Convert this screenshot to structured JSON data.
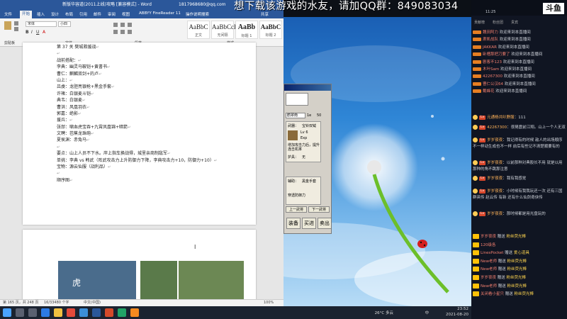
{
  "overlay": {
    "text": "想下载该游戏的水友，请加QQ群：849083034"
  },
  "word": {
    "title": "新版华容道(2011上线)攻略 [兼容模式] - Word",
    "user": "1817968680@qq.com",
    "tabs": [
      "文件",
      "开始",
      "插入",
      "设计",
      "布局",
      "引用",
      "邮件",
      "审阅",
      "视图",
      "ABBYY FineReader 11",
      "操作说明搜索"
    ],
    "active_tab": "开始",
    "share": "共享",
    "font_name": "宋体",
    "font_size": "小四",
    "styles": [
      {
        "sample": "AaBbC",
        "name": "正文"
      },
      {
        "sample": "AaBbCcI",
        "name": "无间隔"
      },
      {
        "sample": "AaBb",
        "name": "标题 1"
      },
      {
        "sample": "AaBbC",
        "name": "标题 2"
      }
    ],
    "groups": [
      "剪贴板",
      "字体",
      "段落",
      "样式"
    ],
    "doc_lines": [
      "第 37 关  樊城救援战",
      "",
      "战前搭配：",
      "李典：幽灵马鞍铠+黄書书",
      "曹仁：麒麟双剑+的卢",
      "山上：",
      "吕虔：龙胆亮银枪+黑金手套",
      "许褚：白银麦斗铠",
      "典韦：白银麦",
      "曹洪：风凰羽衣",
      "郭嘉：绝影",
      "援兵：",
      "张郃：啸血虎宝吞+九霄凤凰锦+暗箭",
      "文聘：芭蕉龙珠砲",
      "夏侯渊：赤兔马",
      "",
      "要点：山上人员不下水。岸上指车换战得，城里亲商制敌军",
      "单挑：李典 vs 韩武（阵武攻击力上升防御力下降，李典攻击力+10，防御力+10）",
      "宝物：源云仙服（战利品）",
      "",
      "顺序图"
    ],
    "status": {
      "page": "第 165 页，共 248 页",
      "words": "16/33480 个字",
      "lang": "中文(中国)",
      "zoom": "100%"
    }
  },
  "game": {
    "title": "",
    "select_value": "鹤翠南",
    "field1": "1e",
    "field2": "50",
    "weapon_label": "武器：",
    "weapon_value": "宝铃双钺",
    "level": "Lv 6",
    "exp": "Exp",
    "desc": "增加攻击力后，提升连击机率",
    "armor_label": "护具：",
    "armor_value": "无",
    "acc_label": "辅助：",
    "acc_value": "黑金手套",
    "acc_desc": "穿透防御力",
    "btn_prev": "上一武将",
    "btn_next": "下一武将",
    "btn_equip": "装备",
    "btn_buy": "买进",
    "btn_sell": "卖出"
  },
  "taskbar": {
    "weather": "26°C  多云",
    "ime": "中",
    "time": "23:52",
    "date": "2021-08-20"
  },
  "douyu": {
    "header_time": "11:25",
    "logo": "斗鱼",
    "tabs": [
      "贡献榜",
      "粉丝团",
      "贵宾"
    ],
    "welcome_text": "欢迎来到本直播间",
    "notices": [
      {
        "name": "魏田阿力"
      },
      {
        "name": "肃凯战队"
      },
      {
        "name": "JAKKAR"
      },
      {
        "name": "卧槽那把刀要了"
      },
      {
        "name": "剧客不123"
      },
      {
        "name": "木叶Sam"
      },
      {
        "name": "42267300"
      },
      {
        "name": "曹仁公汉64"
      },
      {
        "name": "戴蜂花"
      }
    ],
    "chats": [
      {
        "name": "元通杨共叭野服",
        "text": "111"
      },
      {
        "name": "42267300",
        "text": "很晃震前江翔。山上一个人无双"
      },
      {
        "name": "岁岁夜夜",
        "text": "我记得有的时候 敌人的出场顺序不一样动生成也不一样 前后有些记不清楚顺要有的"
      },
      {
        "name": "岁岁夜夜",
        "text": "以前那种对典股长不用 就是以用那种的角不跳那注意"
      },
      {
        "name": "岁岁夜夜",
        "text": "我有我感觉"
      },
      {
        "name": "岁岁夜夜",
        "text": "小时候有我我玩还一次 还有三国群英传 赵云传 有新 还有什么仙剑奇侠传"
      },
      {
        "name": "岁岁夜夜",
        "text": "那时候都是用光盘玩的"
      }
    ],
    "gifts": [
      {
        "name": "岁岁夜夜",
        "verb": "赠送",
        "item": "粉丝荧光棒"
      },
      {
        "name": "120级各",
        "verb": "",
        "item": ""
      },
      {
        "name": "LinesPocket",
        "verb": "赠送",
        "item": "爱心道具"
      },
      {
        "name": "New老师",
        "verb": "赠送",
        "item": "粉丝荧光棒"
      },
      {
        "name": "New老师",
        "verb": "赠送",
        "item": "粉丝荧光棒"
      },
      {
        "name": "岁岁夜夜",
        "verb": "赠送",
        "item": "粉丝荧光棒"
      },
      {
        "name": "New老师",
        "verb": "赠送",
        "item": "粉丝荧光棒"
      },
      {
        "name": "关闭看小星只",
        "verb": "赠送",
        "item": "粉丝荧光棒"
      }
    ]
  }
}
